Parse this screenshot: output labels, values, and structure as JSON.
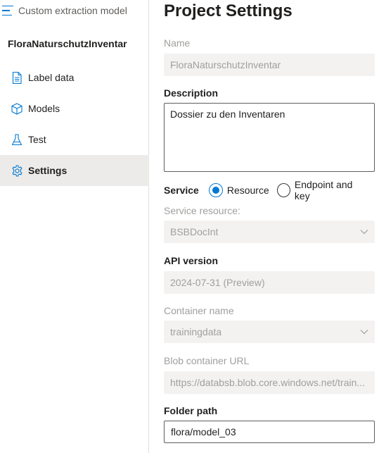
{
  "sidebar": {
    "app_title": "Custom extraction model",
    "project_name": "FloraNaturschutzInventar",
    "items": [
      {
        "label": "Label data",
        "icon": "document-icon"
      },
      {
        "label": "Models",
        "icon": "cube-icon"
      },
      {
        "label": "Test",
        "icon": "flask-icon"
      },
      {
        "label": "Settings",
        "icon": "gear-icon",
        "active": true
      }
    ]
  },
  "main": {
    "title": "Project Settings",
    "name": {
      "label": "Name",
      "value": "FloraNaturschutzInventar"
    },
    "description": {
      "label": "Description",
      "value": "Dossier zu den Inventaren"
    },
    "service": {
      "label": "Service",
      "options": [
        {
          "label": "Resource",
          "selected": true
        },
        {
          "label": "Endpoint and key",
          "selected": false
        }
      ]
    },
    "service_resource": {
      "label": "Service resource:",
      "value": "BSBDocInt"
    },
    "api_version": {
      "label": "API version",
      "value": "2024-07-31 (Preview)"
    },
    "container_name": {
      "label": "Container name",
      "value": "trainingdata"
    },
    "blob_url": {
      "label": "Blob container URL",
      "value": "https://databsb.blob.core.windows.net/train..."
    },
    "folder_path": {
      "label": "Folder path",
      "value": "flora/model_03"
    }
  },
  "colors": {
    "accent": "#0078d4",
    "active_bg": "#edebe9",
    "disabled_field_bg": "#f3f2f1",
    "disabled_text": "#a19f9d"
  }
}
